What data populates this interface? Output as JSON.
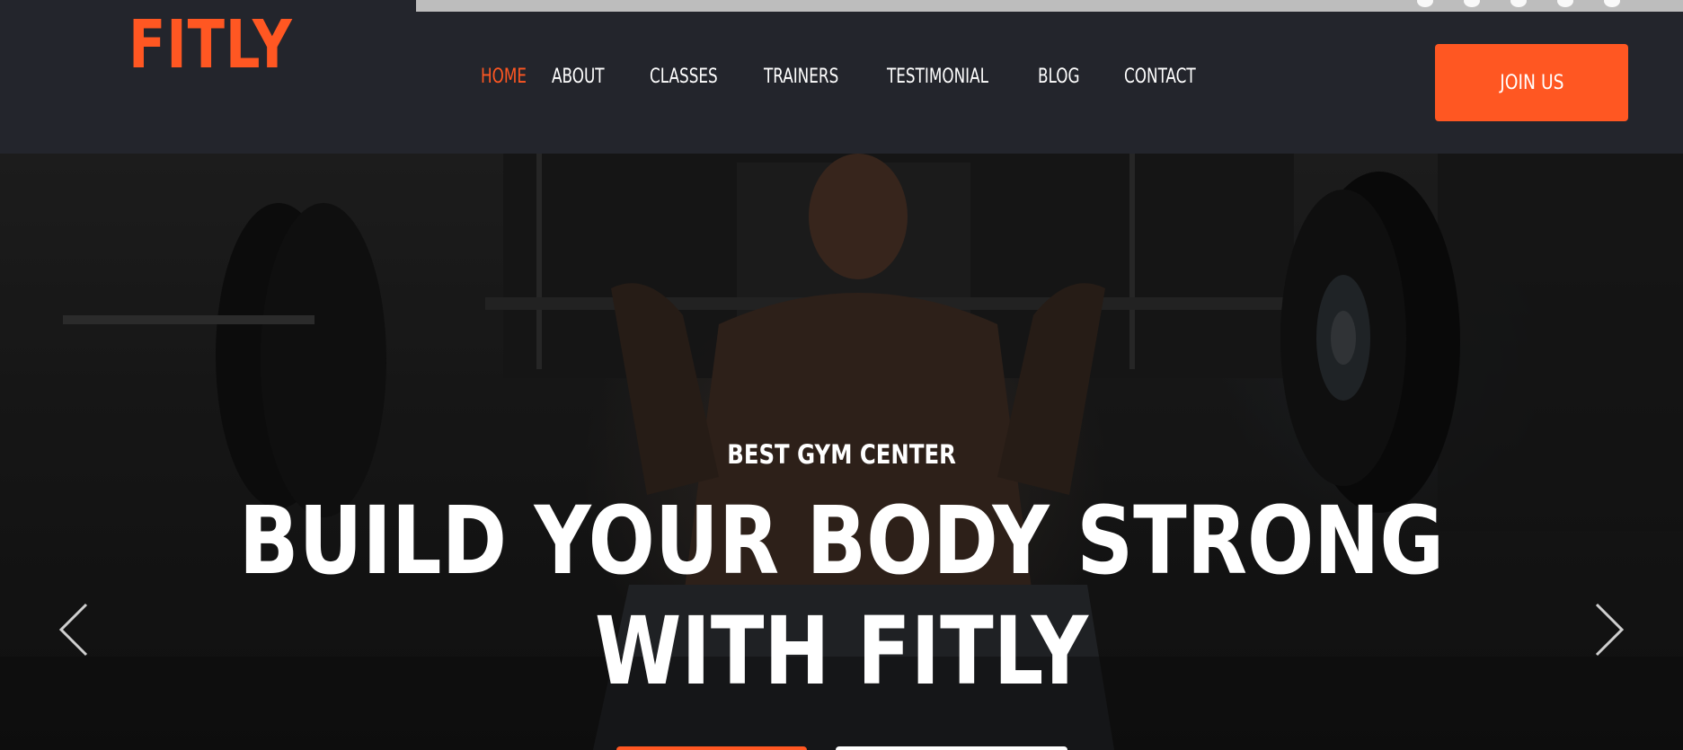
{
  "brand": {
    "logo": "FITLY",
    "accent_color": "#ff5722"
  },
  "nav": {
    "items": [
      {
        "label": "HOME",
        "active": true
      },
      {
        "label": "ABOUT",
        "active": false
      },
      {
        "label": "CLASSES",
        "active": false
      },
      {
        "label": "TRAINERS",
        "active": false
      },
      {
        "label": "TESTIMONIAL",
        "active": false
      },
      {
        "label": "BLOG",
        "active": false
      },
      {
        "label": "CONTACT",
        "active": false
      }
    ]
  },
  "header": {
    "cta_label": "JOIN US"
  },
  "hero": {
    "subtitle": "BEST GYM CENTER",
    "title_line_1": "BUILD YOUR BODY STRONG",
    "title_line_2": "WITH FITLY",
    "prev_icon": "chevron-left-icon",
    "next_icon": "chevron-right-icon"
  }
}
